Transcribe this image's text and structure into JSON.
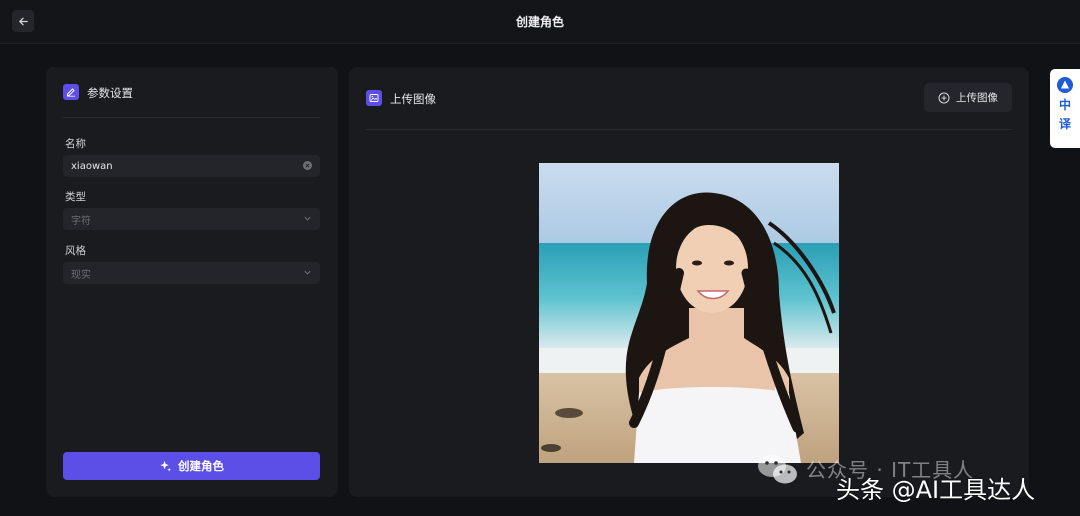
{
  "header": {
    "title": "创建角色"
  },
  "left_panel": {
    "title": "参数设置",
    "fields": {
      "name": {
        "label": "名称",
        "value": "xiaowan"
      },
      "type": {
        "label": "类型",
        "placeholder": "字符"
      },
      "style": {
        "label": "风格",
        "placeholder": "现实"
      }
    },
    "create_button": "创建角色"
  },
  "right_panel": {
    "title": "上传图像",
    "upload_button": "上传图像"
  },
  "side_tab": {
    "char1": "中",
    "char2": "译"
  },
  "watermark": {
    "line1": "公众号 · IT工具人",
    "line2": "头条 @AI工具达人"
  },
  "colors": {
    "accent": "#5b4fe8",
    "panel": "#1a1b1f",
    "background": "#111215"
  }
}
